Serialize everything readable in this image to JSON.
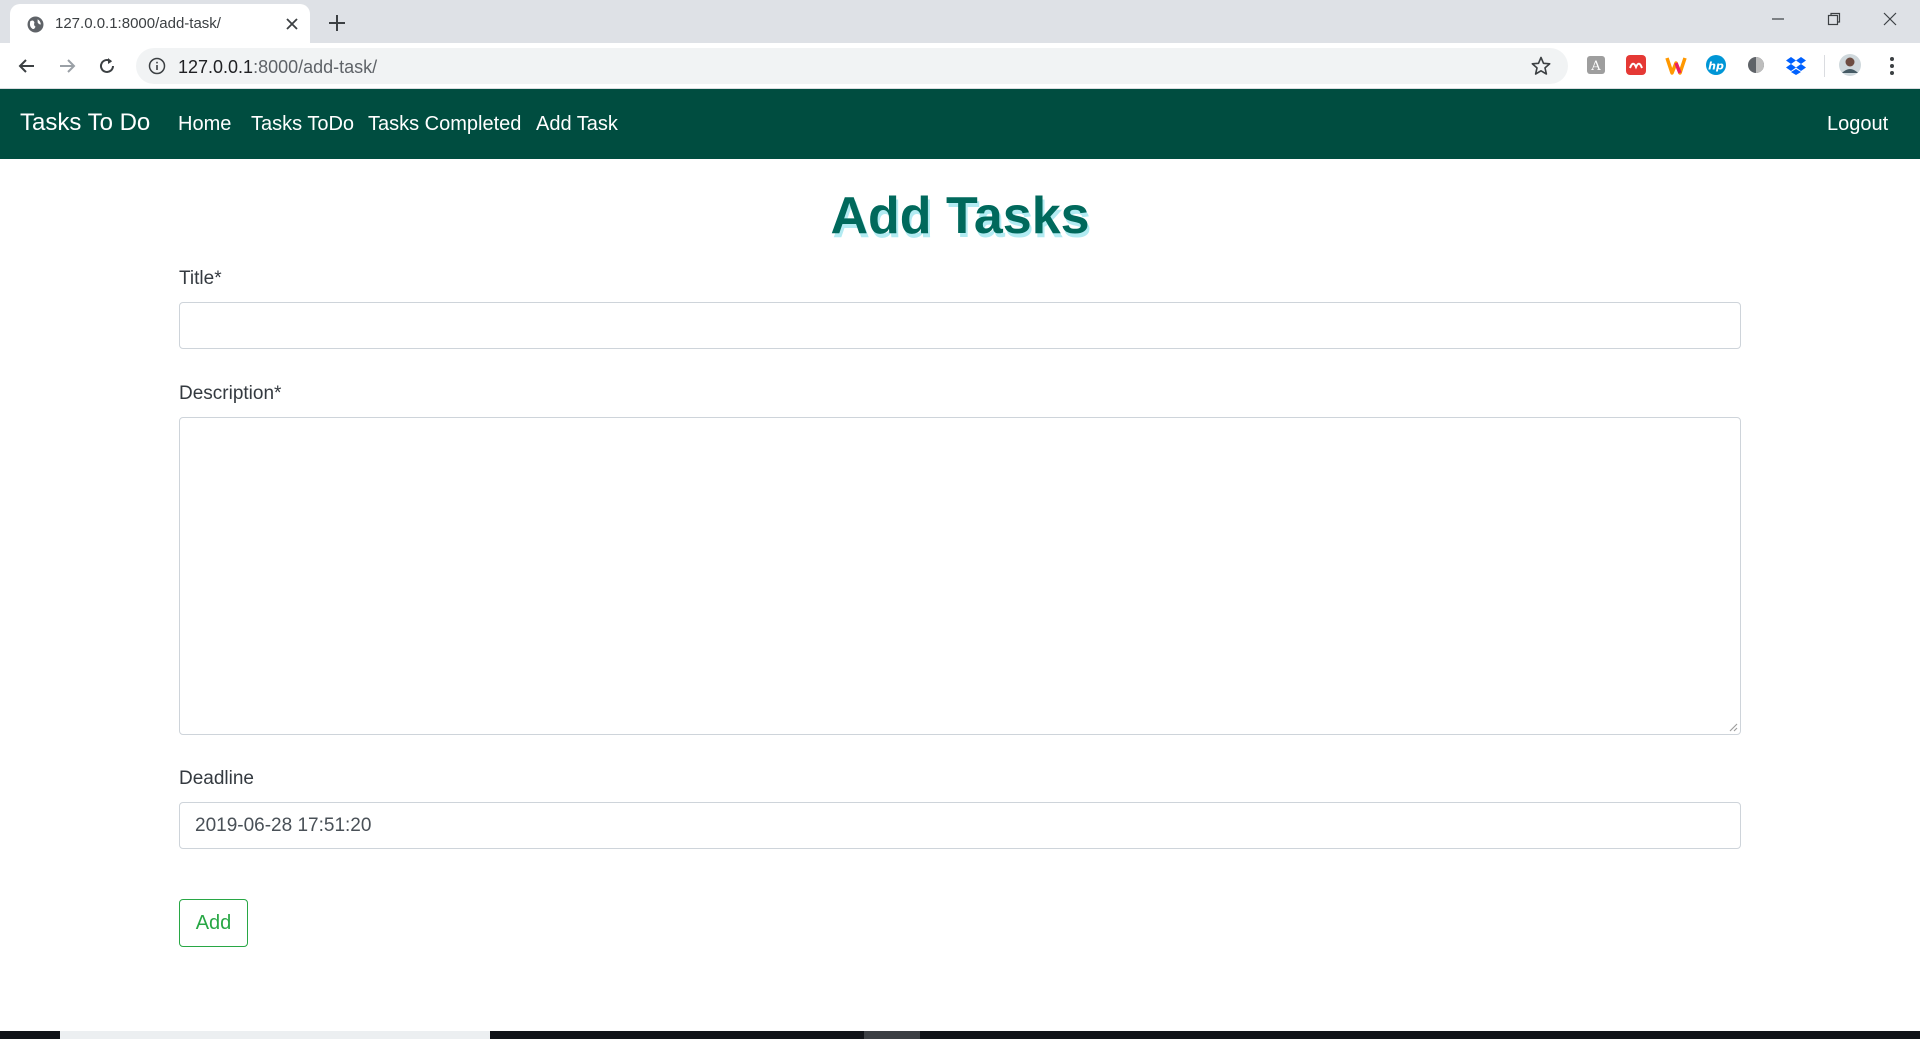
{
  "browser": {
    "tab_title": "127.0.0.1:8000/add-task/",
    "url_host": "127.0.0.1",
    "url_path": ":8000/add-task/"
  },
  "navbar": {
    "brand": "Tasks To Do",
    "links": [
      "Home",
      "Tasks ToDo",
      "Tasks Completed",
      "Add Task"
    ],
    "logout": "Logout"
  },
  "form": {
    "heading": "Add Tasks",
    "title_label": "Title*",
    "title_value": "",
    "description_label": "Description*",
    "description_value": "",
    "deadline_label": "Deadline",
    "deadline_value": "2019-06-28 17:51:20",
    "submit_label": "Add"
  },
  "colors": {
    "navbar_bg": "#004d40",
    "heading": "#00695c",
    "heading_shadow": "#b2ebf2",
    "button_outline": "#28a745"
  },
  "icons": {
    "tab": [
      "globe-icon",
      "close-icon",
      "plus-icon"
    ],
    "window": [
      "minimize-icon",
      "restore-icon",
      "close-icon"
    ],
    "toolbar": [
      "back-arrow-icon",
      "forward-arrow-icon",
      "reload-icon",
      "info-icon",
      "star-icon",
      "kebab-menu-icon"
    ],
    "extensions": [
      "grammar-extension-icon",
      "red-extension-icon",
      "w-extension-icon",
      "hp-extension-icon",
      "circle-extension-icon",
      "dropbox-icon",
      "profile-avatar-icon"
    ]
  }
}
